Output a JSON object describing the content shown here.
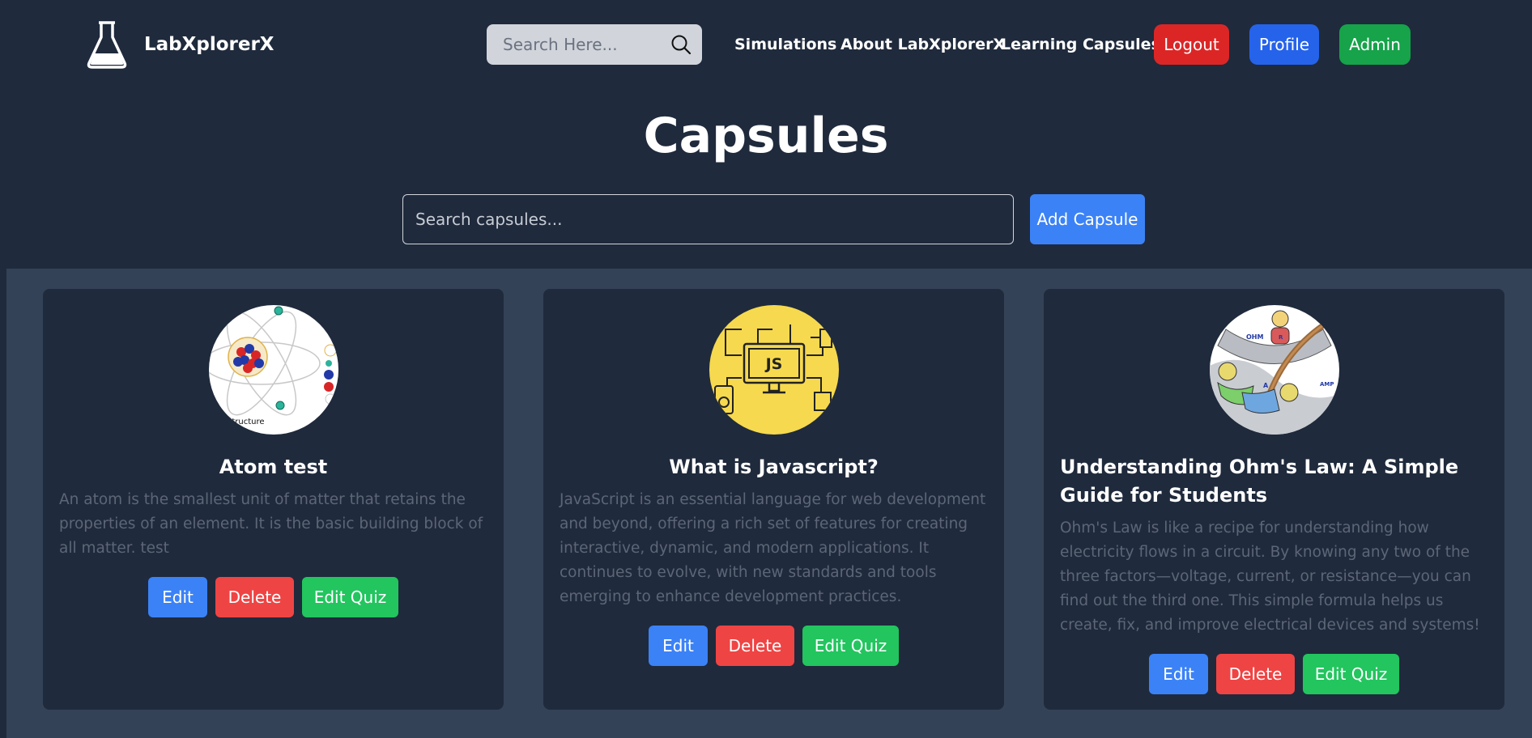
{
  "brand": {
    "name": "LabXplorerX",
    "logo_icon": "flask-icon"
  },
  "nav": {
    "search_placeholder": "Search Here...",
    "links": [
      "Simulations",
      "About LabXplorerX",
      "Learning Capsules"
    ],
    "logout_label": "Logout",
    "profile_label": "Profile",
    "admin_label": "Admin"
  },
  "page": {
    "title": "Capsules",
    "search_placeholder": "Search capsules...",
    "add_label": "Add Capsule"
  },
  "capsules": [
    {
      "title": "Atom test",
      "description": "An atom is the smallest unit of matter that retains the properties of an element. It is the basic building block of all matter. test",
      "image_caption": "Structure",
      "edit_label": "Edit",
      "delete_label": "Delete",
      "quiz_label": "Edit Quiz"
    },
    {
      "title": "What is Javascript?",
      "description": "JavaScript is an essential language for web development and beyond, offering a rich set of features for creating interactive, dynamic, and modern applications. It continues to evolve, with new standards and tools emerging to enhance development practices.",
      "image_caption": "JS",
      "edit_label": "Edit",
      "delete_label": "Delete",
      "quiz_label": "Edit Quiz"
    },
    {
      "title": "Understanding Ohm's Law: A Simple Guide for Students",
      "description": "Ohm's Law is like a recipe for understanding how electricity flows in a circuit. By knowing any two of the three factors—voltage, current, or resistance—you can find out the third one. This simple formula helps us create, fix, and improve electrical devices and systems!",
      "image_labels": [
        "OHM",
        "R",
        "A",
        "AMP"
      ],
      "edit_label": "Edit",
      "delete_label": "Delete",
      "quiz_label": "Edit Quiz"
    }
  ],
  "colors": {
    "background": "#1f2a3c",
    "content_panel": "#344257",
    "primary": "#3b82f6",
    "danger": "#ef4444",
    "success": "#22c55e",
    "logout": "#dc2626",
    "profile": "#2563eb",
    "admin": "#16a34a"
  }
}
